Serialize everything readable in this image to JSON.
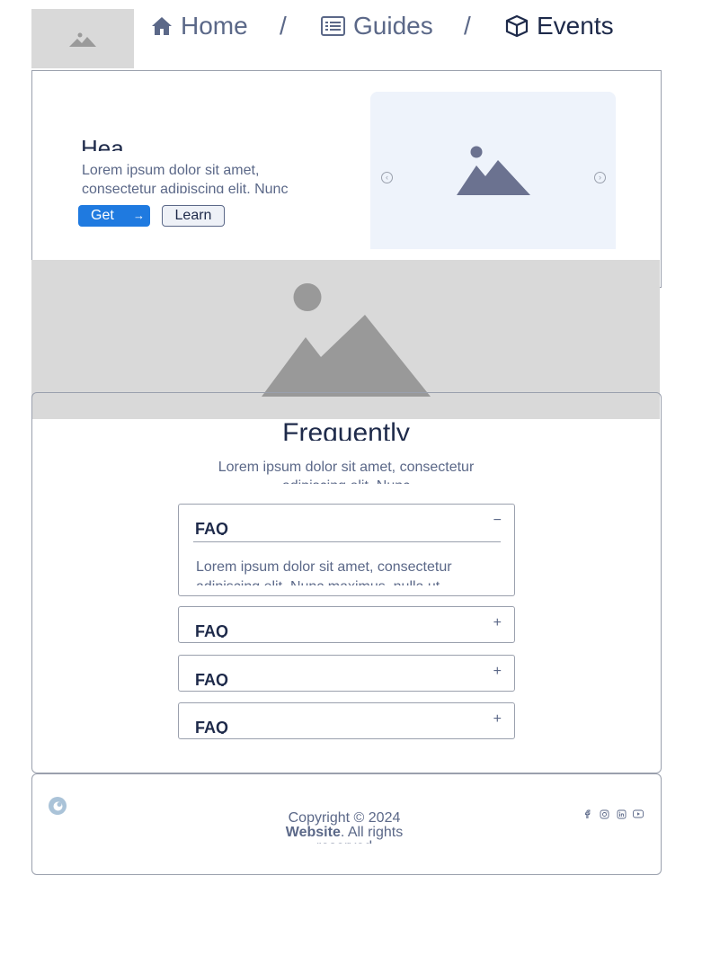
{
  "breadcrumb": {
    "items": [
      {
        "label": "Home",
        "icon": "home-icon"
      },
      {
        "label": "Guides",
        "icon": "list-icon"
      },
      {
        "label": "Events",
        "icon": "box-icon"
      }
    ],
    "separator": "/"
  },
  "hero": {
    "heading": "Hea",
    "text": "Lorem ipsum dolor sit amet, consectetur adipiscing elit. Nunc",
    "primary_label": "Get",
    "primary_icon": "→",
    "secondary_label": "Learn",
    "carousel_prev": "‹",
    "carousel_next": "›"
  },
  "faq": {
    "title": "Frequently",
    "subtitle": "Lorem ipsum dolor sit amet, consectetur adipiscing elit. Nunc",
    "items": [
      {
        "question": "FAQ",
        "toggle": "−",
        "answer": "Lorem ipsum dolor sit amet, consectetur adipiscing elit. Nunc maximus, nulla ut"
      },
      {
        "question": "FAQ",
        "toggle": "+"
      },
      {
        "question": "FAQ",
        "toggle": "+"
      },
      {
        "question": "FAQ",
        "toggle": "+"
      }
    ]
  },
  "footer": {
    "copyright_line": "Copyright © 2024",
    "brand": "Website",
    "rights": ". All rights reserved",
    "social": [
      "facebook-icon",
      "instagram-icon",
      "linkedin-icon",
      "youtube-icon"
    ]
  },
  "colors": {
    "accent": "#1f7ae0",
    "text_dark": "#1e2a4a",
    "text_muted": "#5b6888",
    "placeholder": "#d9d9d9",
    "carousel_bg": "#eef3fb"
  }
}
